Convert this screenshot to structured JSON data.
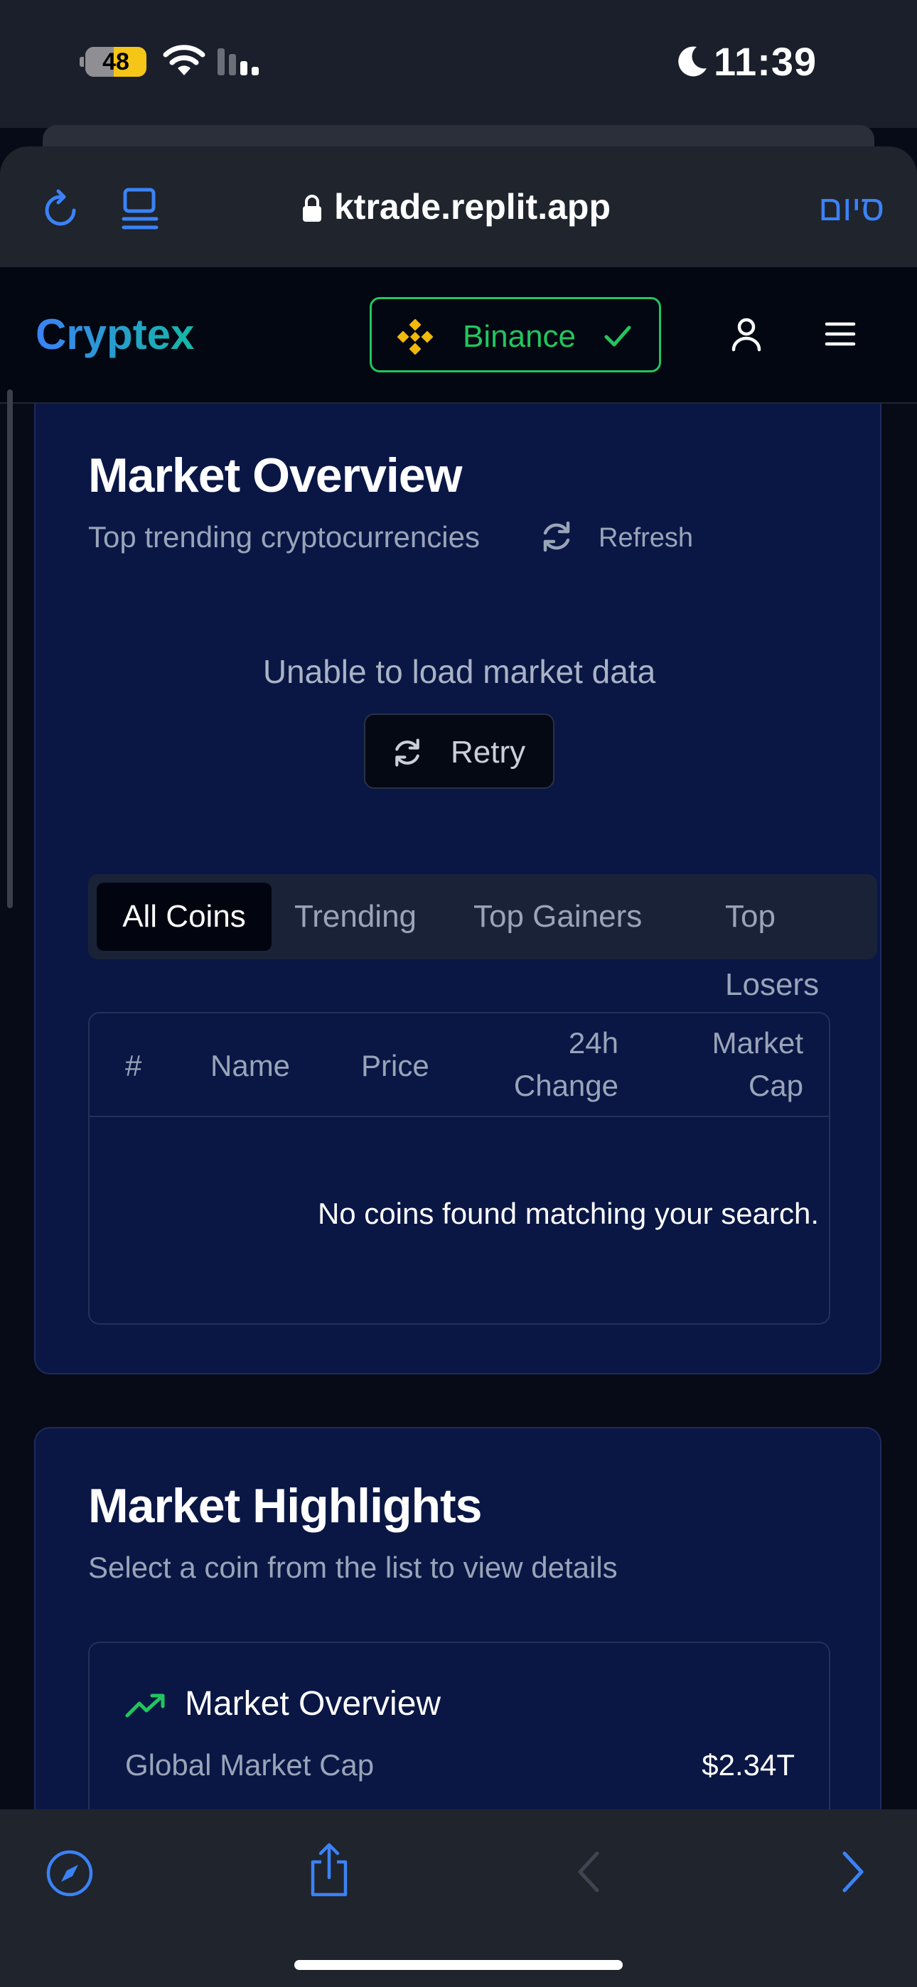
{
  "status_bar": {
    "battery": "48",
    "time": "11:39"
  },
  "browser": {
    "url": "ktrade.replit.app",
    "done_label": "סיום"
  },
  "header": {
    "brand": "Cryptex",
    "exchange": "Binance"
  },
  "market_overview": {
    "title": "Market Overview",
    "subtitle": "Top trending cryptocurrencies",
    "refresh_label": "Refresh",
    "error_message": "Unable to load market data",
    "retry_label": "Retry",
    "tabs": [
      {
        "label": "All Coins",
        "active": true
      },
      {
        "label": "Trending",
        "active": false
      },
      {
        "label": "Top Gainers",
        "active": false
      },
      {
        "label": "Top Losers",
        "active": false
      }
    ],
    "table": {
      "columns": [
        "#",
        "Name",
        "Price",
        "24h Change",
        "Market Cap"
      ],
      "empty_message": "No coins found matching your search."
    }
  },
  "market_highlights": {
    "title": "Market Highlights",
    "subtitle": "Select a coin from the list to view details",
    "panel": {
      "title": "Market Overview",
      "stats": [
        {
          "label": "Global Market Cap",
          "value": "$2.34T"
        }
      ]
    }
  },
  "colors": {
    "accent_green": "#22c55e",
    "accent_blue": "#3b82f6",
    "card_bg": "#0a1745",
    "page_bg": "#070b18"
  },
  "icons": [
    "wifi-icon",
    "signal-icon",
    "moon-icon",
    "reload-icon",
    "reader-icon",
    "lock-icon",
    "binance-icon",
    "check-icon",
    "user-icon",
    "menu-icon",
    "refresh-icon",
    "trend-up-icon",
    "compass-icon",
    "share-icon",
    "back-icon",
    "forward-icon"
  ]
}
